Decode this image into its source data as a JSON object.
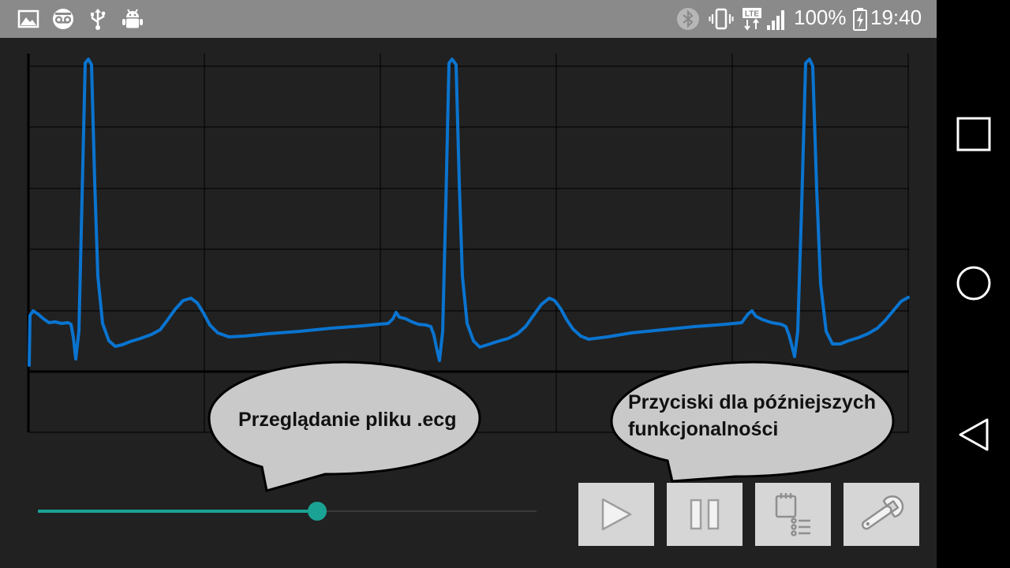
{
  "status_bar": {
    "left_icons": [
      "gallery-icon",
      "voicemail-icon",
      "usb-icon",
      "android-debug-icon"
    ],
    "right_icons": [
      "bluetooth-icon",
      "vibrate-icon",
      "lte-icon",
      "signal-icon",
      "battery-charging-icon"
    ],
    "battery": "100%",
    "time": "19:40"
  },
  "navigation_bar": {
    "buttons": [
      "recents-square-icon",
      "home-circle-icon",
      "back-triangle-icon"
    ]
  },
  "ecg_chart": {
    "line_color": "#0a74d0",
    "grid_color": "#000000",
    "grid": true,
    "vertical_gridlines": 5,
    "horizontal_gridlines": 6
  },
  "callouts": {
    "file_browse": "Przeglądanie pliku .ecg",
    "future_buttons_line1": "Przyciski dla późniejszych",
    "future_buttons_line2": "funkcjonalności"
  },
  "seek_slider": {
    "position_fraction": 0.56,
    "accent_color": "#1aa394"
  },
  "controls": {
    "buttons": [
      "play-icon",
      "pause-icon",
      "file-list-icon",
      "settings-wrench-icon"
    ]
  }
}
